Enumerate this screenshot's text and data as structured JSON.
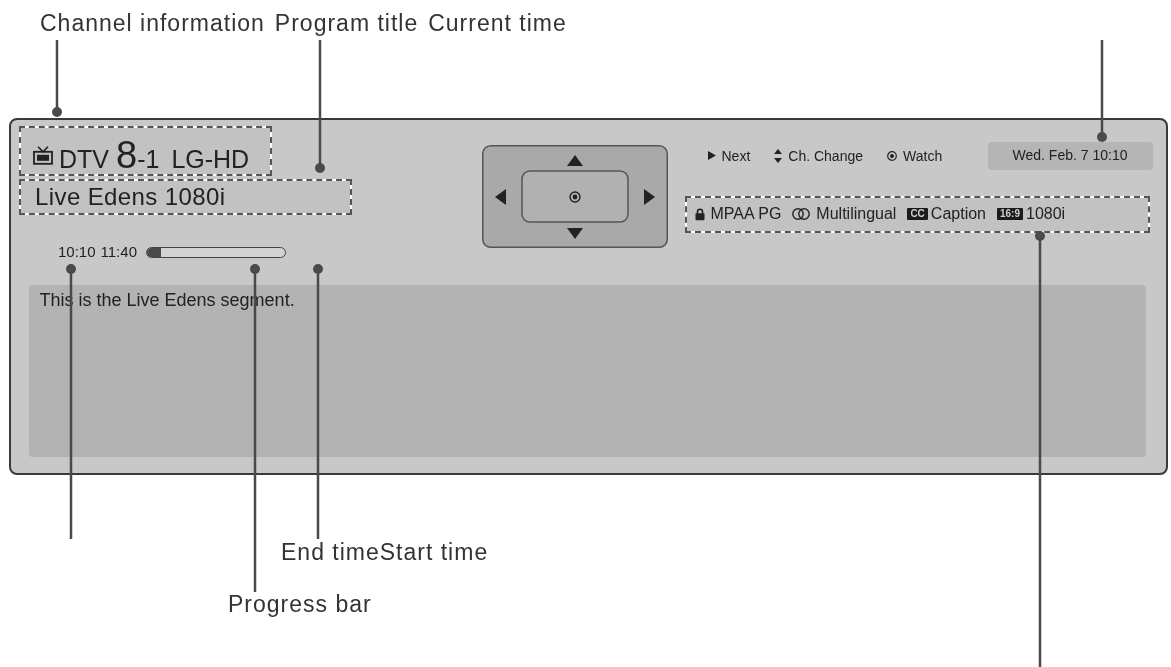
{
  "callouts_top": [
    "Channel information",
    "Program title",
    "Current time"
  ],
  "banner": {
    "channel": {
      "type": "DTV",
      "major": "8",
      "minor": "-1",
      "name": "LG-HD"
    },
    "program_title": "Live Edens 1080i",
    "start_time": "10:10",
    "end_time": "11:40",
    "progress": {
      "level": 0.1
    },
    "key_hints": [
      {
        "kind": "next",
        "label": "Next"
      },
      {
        "kind": "change",
        "label": "Ch. Change"
      },
      {
        "kind": "watch",
        "label": "Watch"
      }
    ],
    "date_time": "Wed. Feb. 7 10:10",
    "info": [
      {
        "kind": "rating",
        "label": "MPAA PG"
      },
      {
        "kind": "audio",
        "label": "Multilingual"
      },
      {
        "kind": "badge",
        "badge": "CC",
        "label": "Caption"
      },
      {
        "kind": "badge",
        "badge": "16:9",
        "label": "1080i"
      }
    ],
    "description": "This is the Live Edens segment."
  },
  "callouts_bottom": [
    "End timeStart time",
    "Progress bar"
  ]
}
